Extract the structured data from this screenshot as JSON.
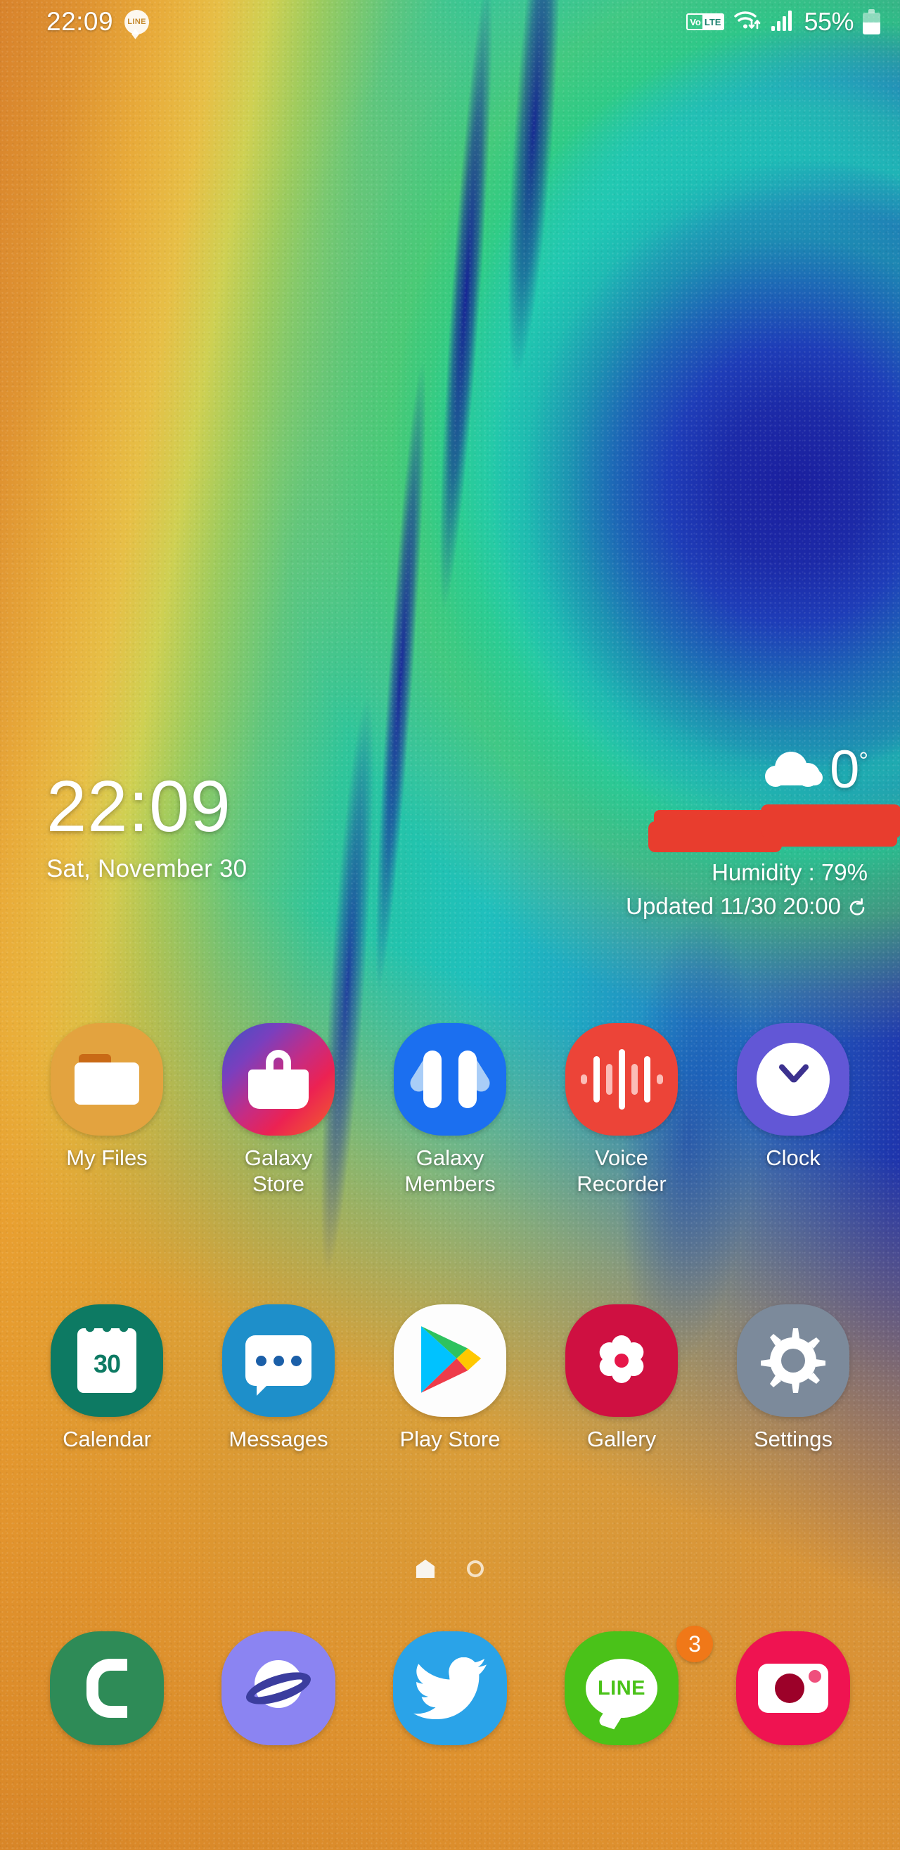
{
  "status_bar": {
    "clock": "22:09",
    "notification_icons": [
      {
        "name": "line-notification-icon",
        "label": "LINE"
      }
    ],
    "volte_prefix": "Vo",
    "volte_suffix": "LTE",
    "wifi_icon": "wifi-icon",
    "signal_icon": "cellular-signal-icon",
    "battery_percent": "55%",
    "battery_icon": "battery-icon"
  },
  "clock_widget": {
    "time": "22:09",
    "date": "Sat, November 30"
  },
  "weather_widget": {
    "condition_icon": "cloud-icon",
    "temperature": "0",
    "degree_symbol": "°",
    "location_redacted": true,
    "humidity": "Humidity : 79%",
    "updated": "Updated 11/30 20:00",
    "refresh_icon": "refresh-icon"
  },
  "app_rows": [
    {
      "apps": [
        {
          "label": "My Files",
          "icon": "my-files-icon",
          "color": "#e3a33f"
        },
        {
          "label": "Galaxy\nStore",
          "icon": "galaxy-store-icon",
          "color": "#c52c84"
        },
        {
          "label": "Galaxy\nMembers",
          "icon": "galaxy-members-icon",
          "color": "#1b6ff0"
        },
        {
          "label": "Voice\nRecorder",
          "icon": "voice-recorder-icon",
          "color": "#ec4438"
        },
        {
          "label": "Clock",
          "icon": "clock-app-icon",
          "color": "#6257d6"
        }
      ]
    },
    {
      "apps": [
        {
          "label": "Calendar",
          "icon": "calendar-icon",
          "color": "#0d7a63",
          "day": "30"
        },
        {
          "label": "Messages",
          "icon": "messages-icon",
          "color": "#1e8fca"
        },
        {
          "label": "Play Store",
          "icon": "play-store-icon",
          "color": "#ffffff"
        },
        {
          "label": "Gallery",
          "icon": "gallery-icon",
          "color": "#cf1041"
        },
        {
          "label": "Settings",
          "icon": "settings-icon",
          "color": "#7c8a9b"
        }
      ]
    }
  ],
  "page_indicator": {
    "pages": 2,
    "current": 0,
    "home_icon": "home-page-icon",
    "dot_icon": "page-dot-icon"
  },
  "dock": {
    "apps": [
      {
        "label": "Phone",
        "icon": "phone-icon",
        "color": "#2e8b57"
      },
      {
        "label": "Internet",
        "icon": "internet-icon",
        "color": "#8b84f2"
      },
      {
        "label": "Twitter",
        "icon": "twitter-icon",
        "color": "#2aa3e8"
      },
      {
        "label": "LINE",
        "icon": "line-icon",
        "color": "#4ac219",
        "badge": "3"
      },
      {
        "label": "Camera",
        "icon": "camera-icon",
        "color": "#ef1351"
      }
    ]
  },
  "theme": {
    "wallpaper_orange": "#e3a33f",
    "wallpaper_green": "#2fc59a",
    "wallpaper_teal": "#1fbfbd",
    "wallpaper_blue": "#1b239e",
    "redaction_red": "#e83d2e",
    "badge_orange": "#f07818",
    "text_white": "#ffffff"
  }
}
